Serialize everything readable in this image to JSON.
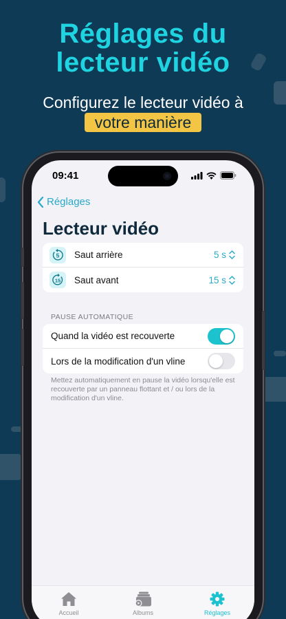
{
  "colors": {
    "background": "#0e3a56",
    "headline": "#1fd3e0",
    "highlight": "#f3c544",
    "accent": "#2aa9c9",
    "toggle_on": "#1cc3cf",
    "toggle_off": "#e6e6eb"
  },
  "promo": {
    "headline_line1": "Réglages du",
    "headline_line2": "lecteur vidéo",
    "subline": "Configurez le lecteur vidéo à",
    "highlight": "votre manière"
  },
  "status_bar": {
    "time": "09:41",
    "icons": [
      "signal-icon",
      "wifi-icon",
      "battery-icon"
    ]
  },
  "nav": {
    "back_label": "Réglages",
    "title": "Lecteur vidéo"
  },
  "skip_settings": [
    {
      "icon": "skip-back-5-icon",
      "icon_text": "5",
      "label": "Saut arrière",
      "value": "5 s"
    },
    {
      "icon": "skip-forward-15-icon",
      "icon_text": "15",
      "label": "Saut avant",
      "value": "15 s"
    }
  ],
  "auto_pause": {
    "header": "PAUSE AUTOMATIQUE",
    "items": [
      {
        "label": "Quand la vidéo est recouverte",
        "enabled": true
      },
      {
        "label": "Lors de la modification d'un vline",
        "enabled": false
      }
    ],
    "footnote": "Mettez automatiquement en pause la vidéo lorsqu'elle est recouverte par un panneau flottant et / ou lors de la modification d'un vline."
  },
  "tabbar": {
    "tabs": [
      {
        "label": "Accueil",
        "icon": "home-icon",
        "active": false
      },
      {
        "label": "Albums",
        "icon": "albums-icon",
        "active": false
      },
      {
        "label": "Réglages",
        "icon": "gear-icon",
        "active": true
      }
    ]
  }
}
